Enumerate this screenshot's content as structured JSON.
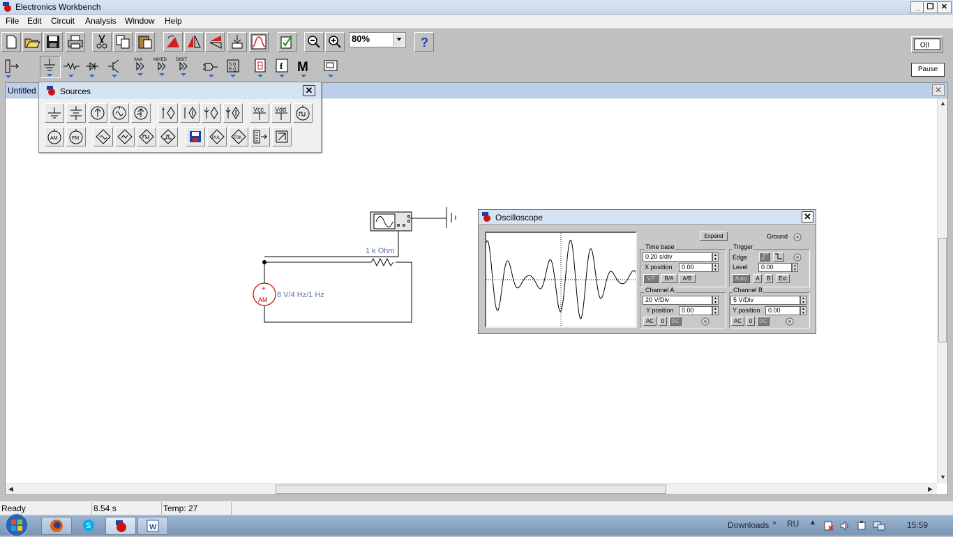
{
  "window": {
    "title": "Electronics Workbench",
    "min": "_",
    "max": "❐",
    "close": "✕"
  },
  "menu": [
    "File",
    "Edit",
    "Circuit",
    "Analysis",
    "Window",
    "Help"
  ],
  "toolbar": {
    "zoom": "80%",
    "help_glyph": "?",
    "pause_label": "Pause",
    "power_label": "O|I",
    "misc_label": "M",
    "func_label": "f"
  },
  "document": {
    "title": "Untitled"
  },
  "sources_palette": {
    "title": "Sources",
    "row1_labels": {
      "vcc": "Vcc",
      "vdd": "Vdd"
    },
    "row2_labels": {
      "am": "AM",
      "fm": "FM",
      "pul": "PUL",
      "fsk": "FSK"
    }
  },
  "circuit": {
    "resistor_label": "1 k Ohm",
    "source_label": "8 V/4 Hz/1 Hz",
    "source_name": "AM",
    "source_plus": "+"
  },
  "oscilloscope": {
    "title": "Oscilloscope",
    "expand": "Expand",
    "ground": "Ground",
    "time_base": {
      "label": "Time base",
      "value": "0.20 s/div",
      "xpos_label": "X position",
      "xpos": "0.00",
      "modes": [
        "Y/T",
        "B/A",
        "A/B"
      ]
    },
    "trigger": {
      "label": "Trigger",
      "edge_label": "Edge",
      "level_label": "Level",
      "level": "0.00",
      "auto": "Auto",
      "a": "A",
      "b": "B",
      "ext": "Ext"
    },
    "channel_a": {
      "label": "Channel A",
      "value": "20  V/Div",
      "ypos_label": "Y position",
      "ypos": "0.00",
      "ac": "AC",
      "zero": "0",
      "dc": "DC"
    },
    "channel_b": {
      "label": "Channel B",
      "value": "5  V/Div",
      "ypos_label": "Y position",
      "ypos": "0.00",
      "ac": "AC",
      "zero": "0",
      "dc": "DC"
    }
  },
  "status": {
    "state": "Ready",
    "time": "8.54 s",
    "temp": "Temp:  27"
  },
  "taskbar": {
    "downloads": "Downloads",
    "downloads_arrow": "»",
    "lang": "RU",
    "clock": "15:59"
  },
  "colors": {
    "component_red": "#cc0000",
    "label_blue": "#5a6fb0",
    "accent": "#1e6fd9"
  }
}
